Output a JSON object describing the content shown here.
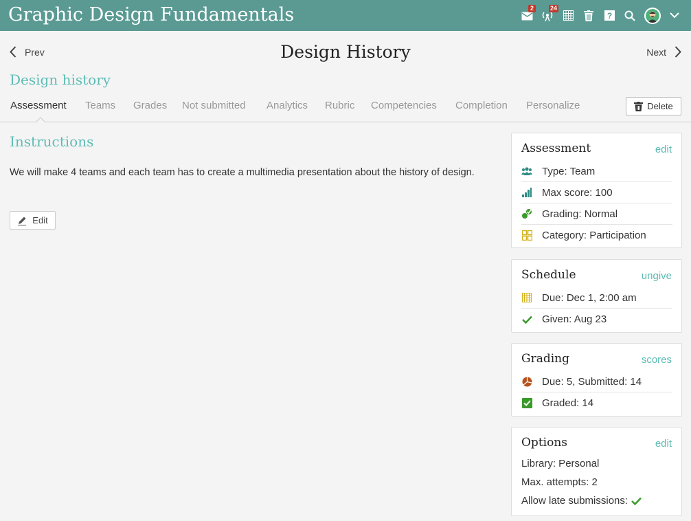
{
  "app": {
    "title": "Graphic Design Fundamentals"
  },
  "topbar": {
    "icons": [
      {
        "name": "mail-icon",
        "badge": "2"
      },
      {
        "name": "broadcast-icon",
        "badge": "24"
      },
      {
        "name": "calendar-icon"
      },
      {
        "name": "trash-icon"
      },
      {
        "name": "help-icon"
      },
      {
        "name": "search-icon"
      },
      {
        "name": "avatar"
      },
      {
        "name": "chevron-down-icon"
      }
    ]
  },
  "nav": {
    "prev_label": "Prev",
    "next_label": "Next",
    "page_title": "Design History"
  },
  "subtitle": "Design history",
  "tabs": [
    "Assessment",
    "Teams",
    "Grades",
    "Not submitted",
    "Analytics",
    "Rubric",
    "Competencies",
    "Completion",
    "Personalize"
  ],
  "active_tab": "Assessment",
  "delete_label": "Delete",
  "instructions": {
    "title": "Instructions",
    "text": "We will make 4 teams and each team has to create a multimedia presentation about the history of design.",
    "edit_label": "Edit"
  },
  "cards": {
    "assessment": {
      "title": "Assessment",
      "link": "edit",
      "rows": [
        "Type: Team",
        "Max score: 100",
        "Grading: Normal",
        "Category: Participation"
      ]
    },
    "schedule": {
      "title": "Schedule",
      "link": "ungive",
      "rows": [
        "Due: Dec 1, 2:00 am",
        "Given: Aug 23"
      ]
    },
    "grading": {
      "title": "Grading",
      "link": "scores",
      "rows": [
        "Due: 5, Submitted: 14",
        "Graded: 14"
      ]
    },
    "options": {
      "title": "Options",
      "link": "edit",
      "rows": [
        "Library: Personal",
        "Max. attempts: 2",
        "Allow late submissions:"
      ]
    }
  },
  "colors": {
    "topbar": "#5a9a93",
    "accent": "#5cbcb4",
    "badge": "#c0392b",
    "check": "#3a9a2a",
    "yellow": "#d4b21c",
    "teal_icon": "#2b8a84"
  }
}
